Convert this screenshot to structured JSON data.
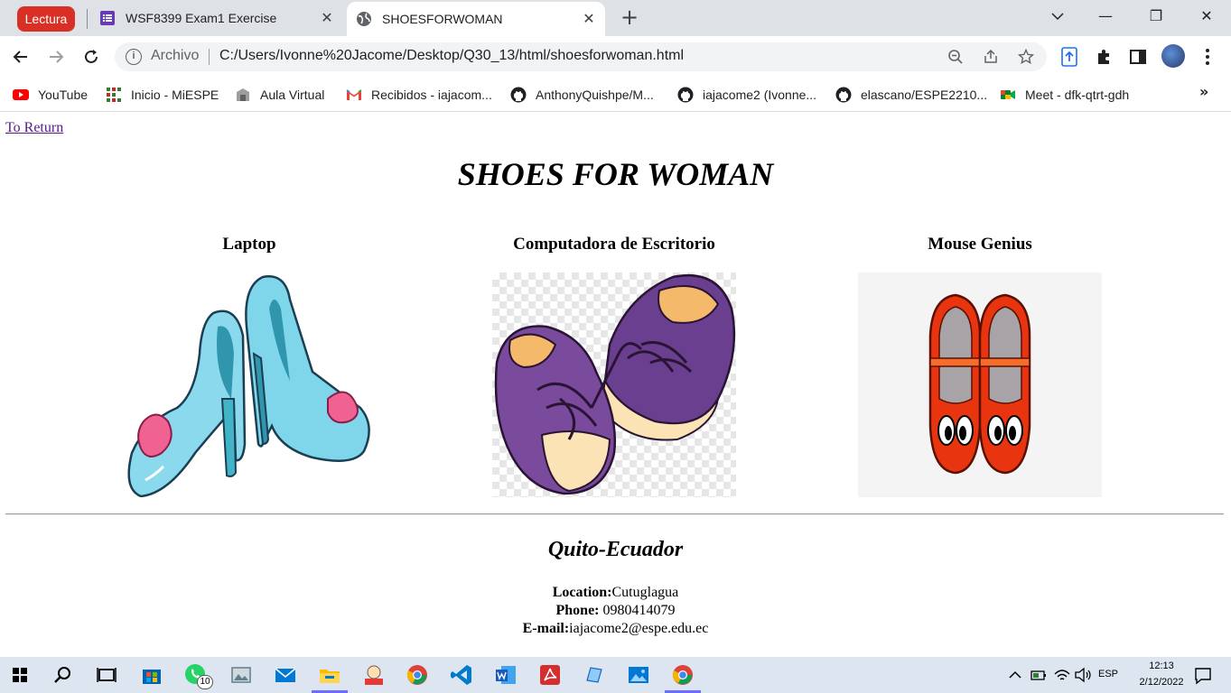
{
  "browser": {
    "reading_mode_label": "Lectura",
    "tabs": [
      {
        "title": "WSF8399 Exam1 Exercise",
        "active": false,
        "icon": "google-forms-icon"
      },
      {
        "title": "SHOESFORWOMAN",
        "active": true,
        "icon": "globe-icon"
      }
    ],
    "close_symbol": "✕",
    "new_tab_symbol": "+",
    "window_controls": {
      "minimize": "—",
      "restore": "❐",
      "close": "✕"
    },
    "address": {
      "origin_label": "Archivo",
      "url": "C:/Users/Ivonne%20Jacome/Desktop/Q30_13/html/shoesforwoman.html"
    },
    "bookmarks": [
      {
        "label": "YouTube",
        "icon": "youtube-icon"
      },
      {
        "label": "Inicio - MiESPE",
        "icon": "miespe-icon"
      },
      {
        "label": "Aula Virtual",
        "icon": "aula-virtual-icon"
      },
      {
        "label": "Recibidos - iajacom...",
        "icon": "gmail-icon"
      },
      {
        "label": "AnthonyQuishpe/M...",
        "icon": "github-icon"
      },
      {
        "label": "iajacome2 (Ivonne...",
        "icon": "github-icon"
      },
      {
        "label": "elascano/ESPE2210...",
        "icon": "github-icon"
      },
      {
        "label": "Meet - dfk-qtrt-gdh",
        "icon": "google-meet-icon"
      }
    ],
    "bookmarks_more": "»"
  },
  "page": {
    "return_link": "To Return",
    "title": "SHOES FOR WOMAN",
    "products": [
      {
        "name": "Laptop",
        "image": "blue-high-heels"
      },
      {
        "name": "Computadora de Escritorio",
        "image": "purple-sneakers"
      },
      {
        "name": "Mouse Genius",
        "image": "red-kids-shoes"
      }
    ],
    "footer": {
      "city": "Quito-Ecuador",
      "location_label": "Location:",
      "location_value": "Cutuglagua",
      "phone_label": "Phone:",
      "phone_value": " 0980414079",
      "email_label": "E-mail:",
      "email_value": "iajacome2@espe.edu.ec"
    }
  },
  "taskbar": {
    "whatsapp_badge": "10",
    "language": "ESP",
    "time": "12:13",
    "date": "2/12/2022"
  },
  "colors": {
    "reading_pill": "#d93025",
    "tab_strip": "#dee1e6",
    "link_visited": "#551a8b",
    "taskbar": "#dde6f0"
  }
}
